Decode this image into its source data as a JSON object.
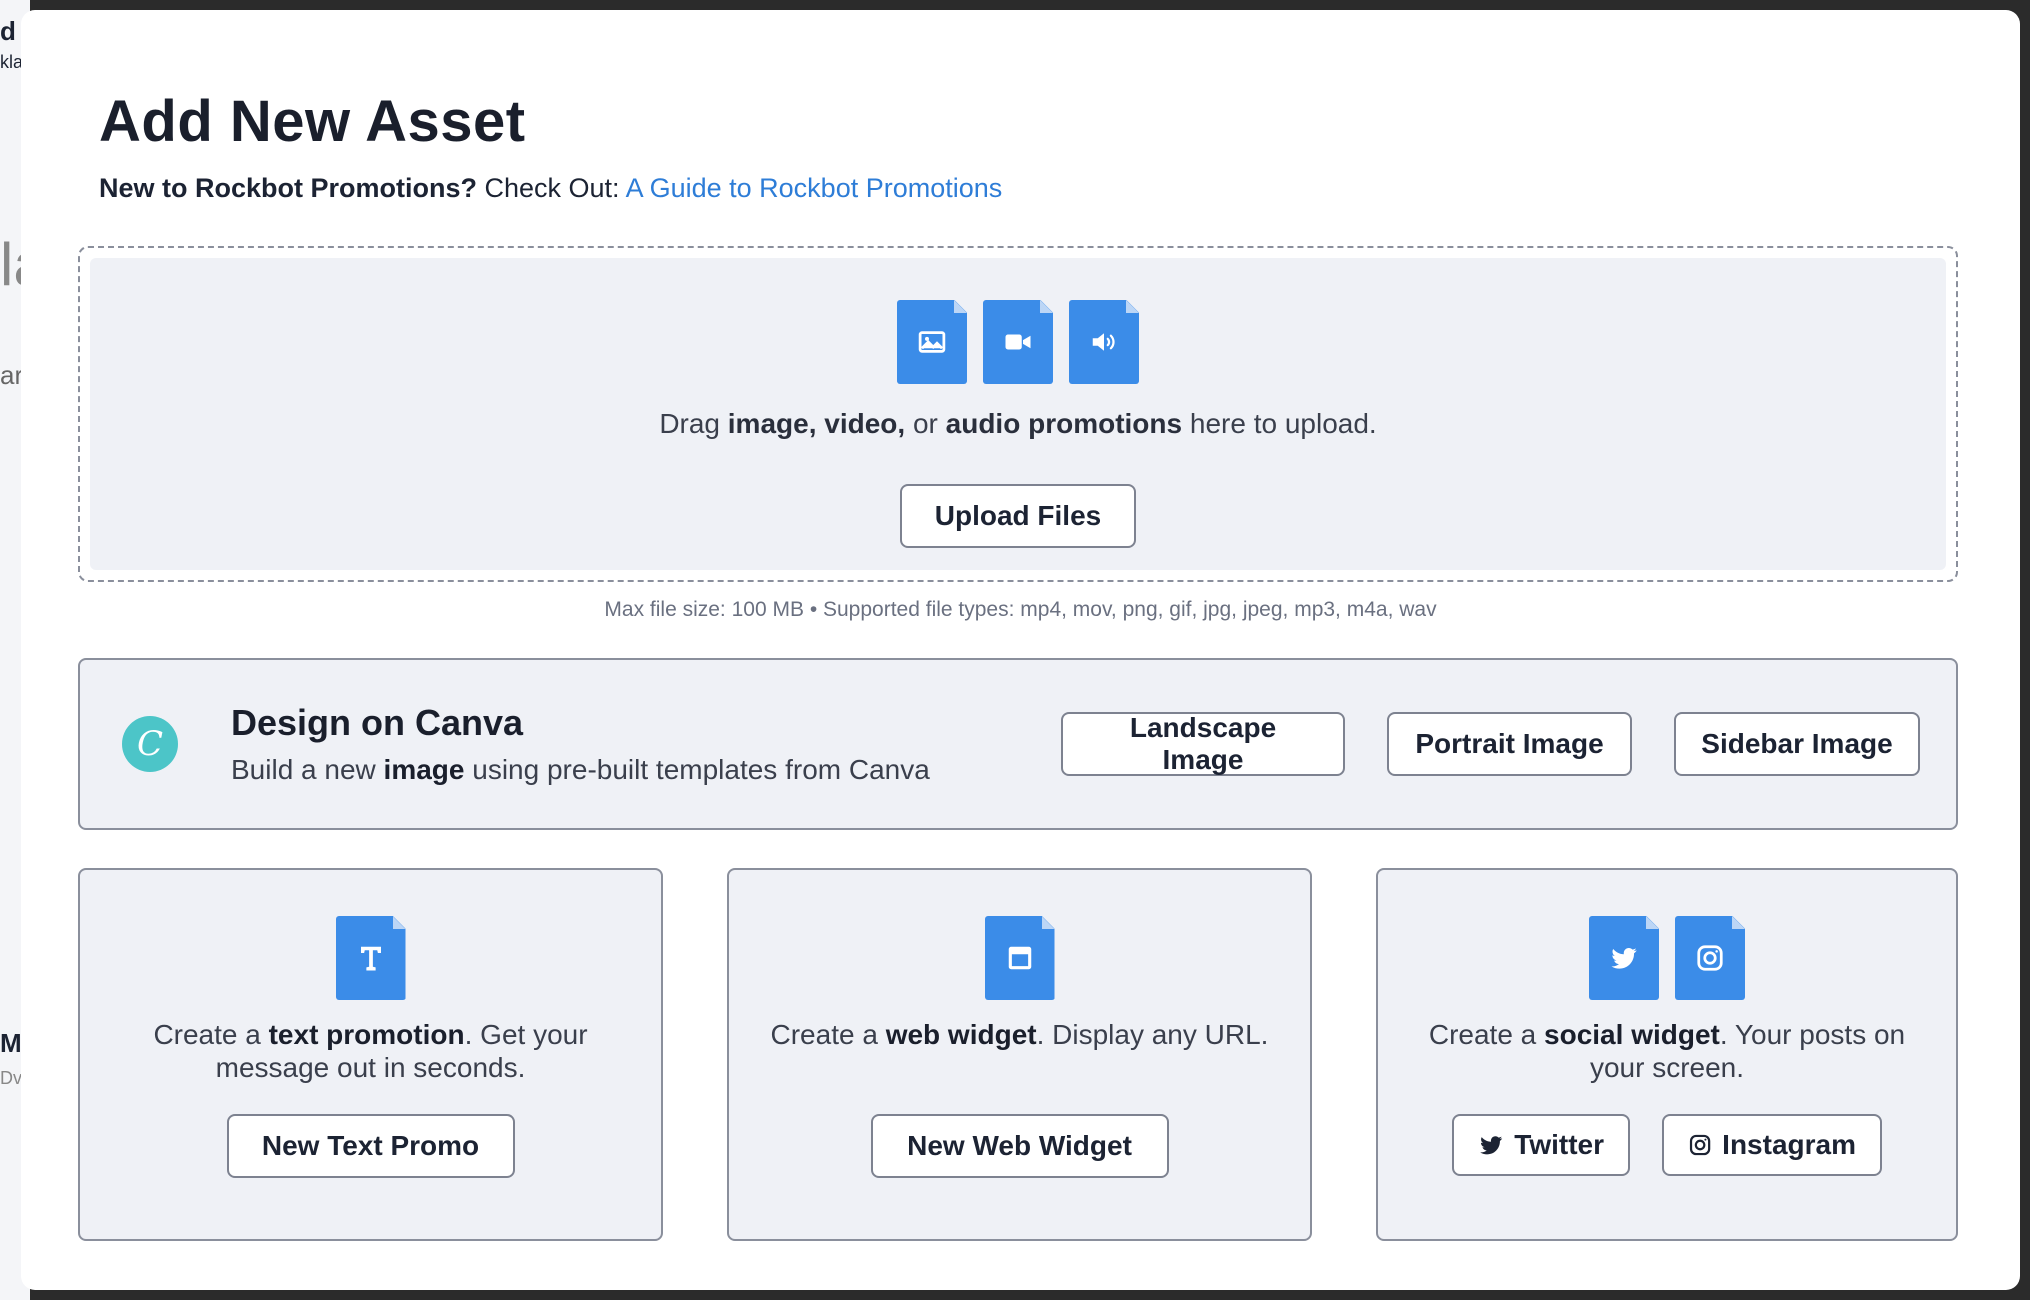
{
  "background_fragments": [
    "d",
    "kla",
    "la",
    "ar",
    "M",
    "Dv"
  ],
  "modal": {
    "title": "Add New Asset",
    "subtitle_bold": "New to Rockbot Promotions?",
    "subtitle_plain": " Check Out: ",
    "guide_link": "A Guide to Rockbot Promotions"
  },
  "upload": {
    "icons": [
      "image-file-icon",
      "video-file-icon",
      "audio-file-icon"
    ],
    "text_prefix": "Drag ",
    "text_bold1": "image, video,",
    "text_mid": " or ",
    "text_bold2": "audio promotions",
    "text_suffix": " here to upload.",
    "button": "Upload Files",
    "hint": "Max file size: 100 MB • Supported file types: mp4, mov, png, gif, jpg, jpeg, mp3, m4a, wav"
  },
  "canva": {
    "logo_letter": "C",
    "title": "Design on Canva",
    "desc_prefix": "Build a new ",
    "desc_bold": "image",
    "desc_suffix": " using pre-built templates from Canva",
    "buttons": [
      "Landscape Image",
      "Portrait Image",
      "Sidebar Image"
    ]
  },
  "cards": {
    "text": {
      "desc_prefix": "Create a ",
      "desc_bold": "text promotion",
      "desc_suffix": ". Get your message out in seconds.",
      "button": "New Text Promo"
    },
    "web": {
      "desc_prefix": "Create a ",
      "desc_bold": "web widget",
      "desc_suffix": ". Display any URL.",
      "button": "New Web Widget"
    },
    "social": {
      "desc_prefix": "Create a ",
      "desc_bold": "social widget",
      "desc_suffix": ". Your posts on your screen.",
      "buttons": [
        "Twitter",
        "Instagram"
      ]
    }
  },
  "colors": {
    "accent_blue": "#3b8ce8",
    "link_blue": "#2e7dd7",
    "canva_teal": "#4cc5c8",
    "panel_bg": "#eff1f6"
  }
}
